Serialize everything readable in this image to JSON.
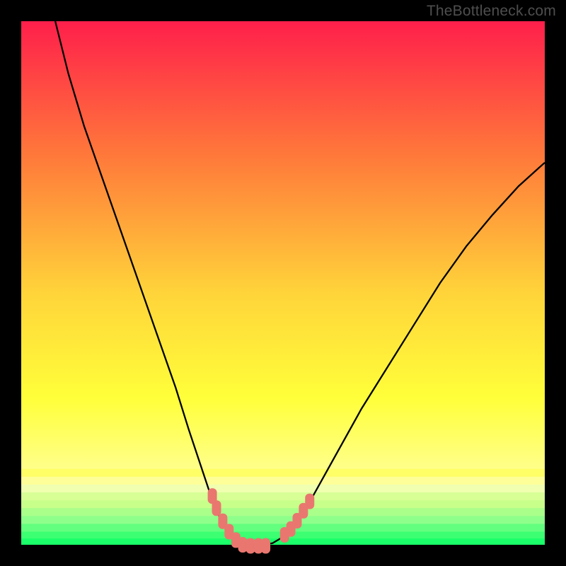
{
  "watermark": "TheBottleneck.com",
  "colors": {
    "frame": "#000000",
    "top_gradient": "#ff1f4b",
    "mid1": "#ff7a3a",
    "mid2": "#ffd43a",
    "yellow": "#ffff3a",
    "pale_yellow": "#ffff99",
    "pale_green1": "#c8ff8b",
    "pale_green2": "#8fff8b",
    "green": "#1aff6a",
    "curve": "#000000",
    "markers": "#e9776f"
  },
  "chart_data": {
    "type": "line",
    "title": "",
    "xlabel": "",
    "ylabel": "",
    "xlim": [
      0,
      100
    ],
    "ylim": [
      0,
      100
    ],
    "curve": [
      {
        "x": 6.5,
        "y": 100
      },
      {
        "x": 9,
        "y": 90
      },
      {
        "x": 12,
        "y": 80
      },
      {
        "x": 15.5,
        "y": 70
      },
      {
        "x": 19,
        "y": 60
      },
      {
        "x": 22.5,
        "y": 50
      },
      {
        "x": 26,
        "y": 40
      },
      {
        "x": 29.5,
        "y": 30
      },
      {
        "x": 32,
        "y": 22
      },
      {
        "x": 34,
        "y": 16
      },
      {
        "x": 36,
        "y": 10
      },
      {
        "x": 38,
        "y": 5
      },
      {
        "x": 40,
        "y": 2
      },
      {
        "x": 42,
        "y": 0.3
      },
      {
        "x": 44,
        "y": 0
      },
      {
        "x": 46,
        "y": 0
      },
      {
        "x": 48,
        "y": 0.3
      },
      {
        "x": 50,
        "y": 1.5
      },
      {
        "x": 52,
        "y": 3.5
      },
      {
        "x": 55,
        "y": 8
      },
      {
        "x": 60,
        "y": 17
      },
      {
        "x": 65,
        "y": 26
      },
      {
        "x": 70,
        "y": 34
      },
      {
        "x": 75,
        "y": 42
      },
      {
        "x": 80,
        "y": 50
      },
      {
        "x": 85,
        "y": 57
      },
      {
        "x": 90,
        "y": 63
      },
      {
        "x": 95,
        "y": 68.5
      },
      {
        "x": 100,
        "y": 73
      }
    ],
    "markers_left": [
      {
        "x": 36.5,
        "y": 9.3
      },
      {
        "x": 37.3,
        "y": 7.0
      },
      {
        "x": 38.5,
        "y": 4.5
      },
      {
        "x": 39.7,
        "y": 2.5
      },
      {
        "x": 41.0,
        "y": 0.9
      },
      {
        "x": 42.3,
        "y": 0.0
      },
      {
        "x": 43.8,
        "y": -0.2
      },
      {
        "x": 45.3,
        "y": -0.2
      },
      {
        "x": 46.7,
        "y": -0.2
      }
    ],
    "markers_right": [
      {
        "x": 50.3,
        "y": 1.9
      },
      {
        "x": 51.5,
        "y": 3.0
      },
      {
        "x": 52.7,
        "y": 4.6
      },
      {
        "x": 53.9,
        "y": 6.5
      },
      {
        "x": 55.1,
        "y": 8.3
      }
    ],
    "annotations": []
  }
}
